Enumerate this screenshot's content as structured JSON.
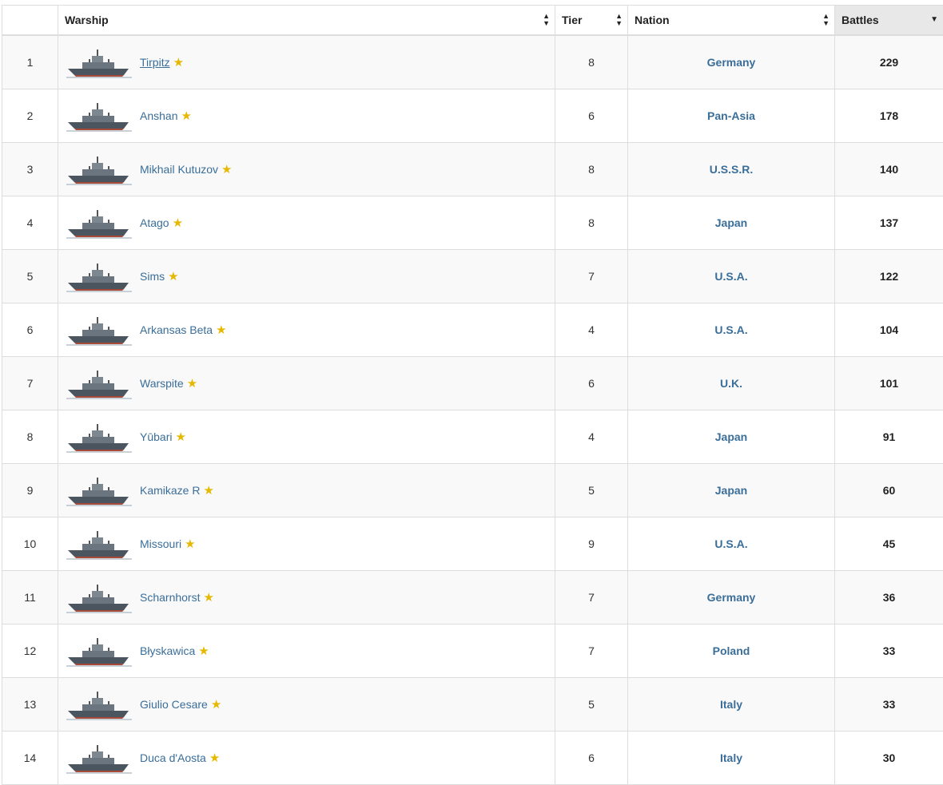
{
  "columns": {
    "rank": "",
    "warship": "Warship",
    "tier": "Tier",
    "nation": "Nation",
    "battles": "Battles"
  },
  "rows": [
    {
      "rank": "1",
      "name": "Tirpitz",
      "tier": "8",
      "nation": "Germany",
      "battles": "229"
    },
    {
      "rank": "2",
      "name": "Anshan",
      "tier": "6",
      "nation": "Pan-Asia",
      "battles": "178"
    },
    {
      "rank": "3",
      "name": "Mikhail Kutuzov",
      "tier": "8",
      "nation": "U.S.S.R.",
      "battles": "140"
    },
    {
      "rank": "4",
      "name": "Atago",
      "tier": "8",
      "nation": "Japan",
      "battles": "137"
    },
    {
      "rank": "5",
      "name": "Sims",
      "tier": "7",
      "nation": "U.S.A.",
      "battles": "122"
    },
    {
      "rank": "6",
      "name": "Arkansas Beta",
      "tier": "4",
      "nation": "U.S.A.",
      "battles": "104"
    },
    {
      "rank": "7",
      "name": "Warspite",
      "tier": "6",
      "nation": "U.K.",
      "battles": "101"
    },
    {
      "rank": "8",
      "name": "Yūbari",
      "tier": "4",
      "nation": "Japan",
      "battles": "91"
    },
    {
      "rank": "9",
      "name": "Kamikaze R",
      "tier": "5",
      "nation": "Japan",
      "battles": "60"
    },
    {
      "rank": "10",
      "name": "Missouri",
      "tier": "9",
      "nation": "U.S.A.",
      "battles": "45"
    },
    {
      "rank": "11",
      "name": "Scharnhorst",
      "tier": "7",
      "nation": "Germany",
      "battles": "36"
    },
    {
      "rank": "12",
      "name": "Błyskawica",
      "tier": "7",
      "nation": "Poland",
      "battles": "33"
    },
    {
      "rank": "13",
      "name": "Giulio Cesare",
      "tier": "5",
      "nation": "Italy",
      "battles": "33"
    },
    {
      "rank": "14",
      "name": "Duca d'Aosta",
      "tier": "6",
      "nation": "Italy",
      "battles": "30"
    }
  ],
  "colors": {
    "link": "#3a6e99",
    "star": "#e6b800",
    "sorted_header": "#e8e8e8"
  }
}
